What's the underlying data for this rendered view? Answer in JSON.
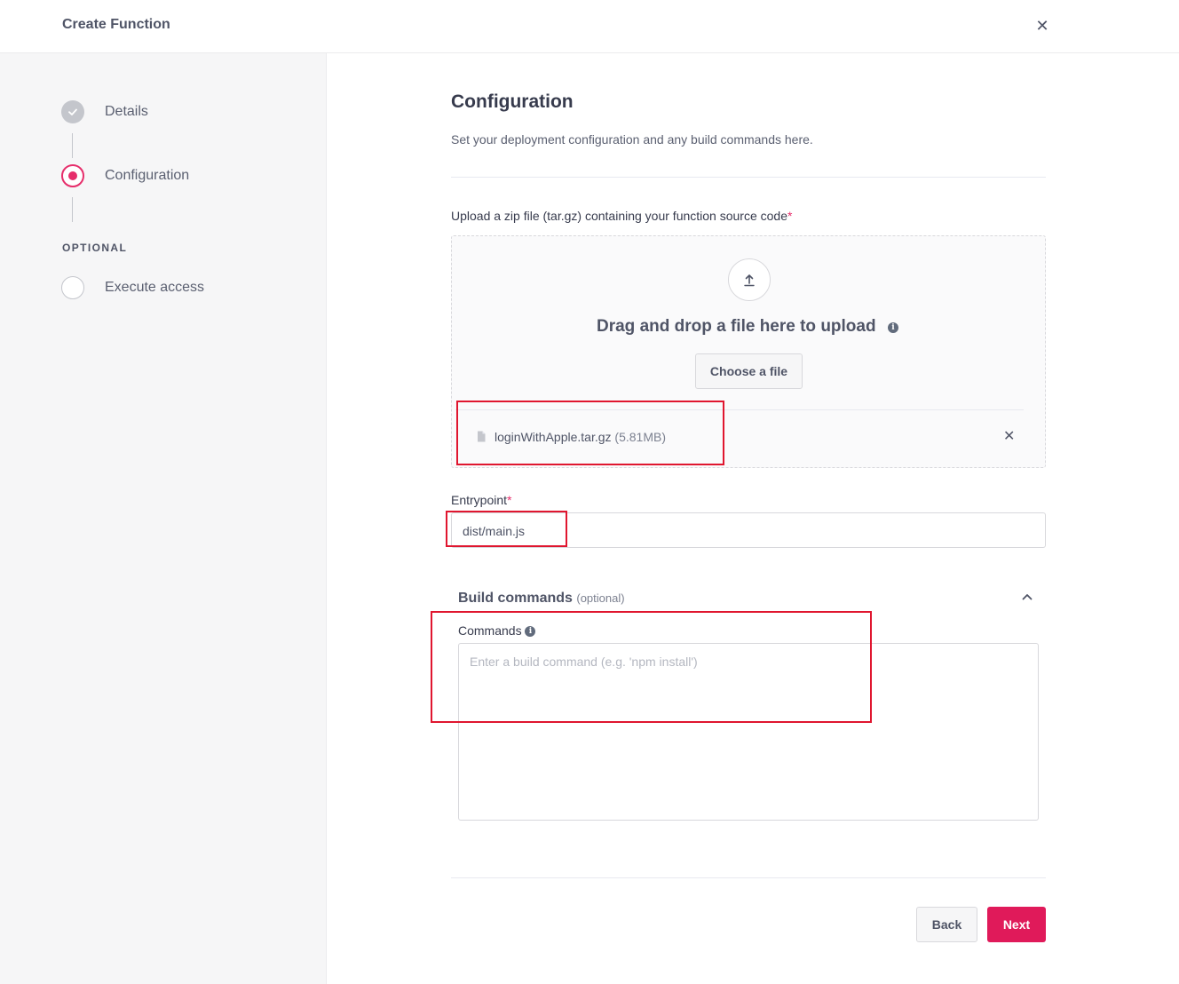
{
  "header": {
    "title": "Create Function",
    "close_icon": "close-icon"
  },
  "steps": {
    "details": "Details",
    "configuration": "Configuration",
    "optional_label": "OPTIONAL",
    "execute_access": "Execute access"
  },
  "page": {
    "title": "Configuration",
    "subtitle": "Set your deployment configuration and any build commands here."
  },
  "upload": {
    "label": "Upload a zip file (tar.gz) containing your function source code",
    "required_mark": "*",
    "drag_text": "Drag and drop a file here to upload",
    "info_glyph": "i",
    "choose_label": "Choose a file",
    "file_name": "loginWithApple.tar.gz",
    "file_size": "(5.81MB)"
  },
  "entrypoint": {
    "label": "Entrypoint",
    "required_mark": "*",
    "value": "dist/main.js"
  },
  "build": {
    "title": "Build commands",
    "optional": "(optional)",
    "commands_label": "Commands",
    "info_glyph": "i",
    "placeholder": "Enter a build command (e.g. 'npm install')"
  },
  "footer": {
    "back_label": "Back",
    "next_label": "Next"
  },
  "colors": {
    "accent": "#e01a5a",
    "highlight": "#e0162f"
  }
}
